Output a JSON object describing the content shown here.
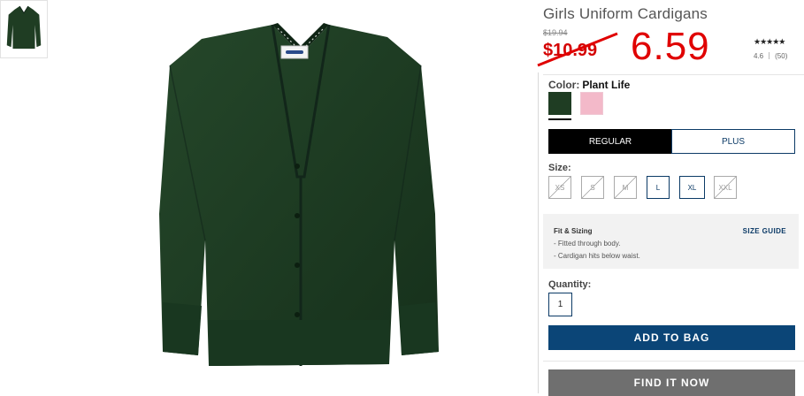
{
  "product": {
    "title": "Girls Uniform Cardigans",
    "old_price": "$19.94",
    "sale_price": "$10.99",
    "new_price": "6.59",
    "rating_stars": "★★★★★",
    "rating_value": "4.6",
    "review_count": "(50)"
  },
  "color": {
    "label": "Color:",
    "selected": "Plant Life",
    "swatches": [
      {
        "name": "Plant Life",
        "hex": "#1f3d23"
      },
      {
        "name": "pink",
        "hex": "#f3b9c9"
      }
    ]
  },
  "fit_tabs": {
    "regular": "REGULAR",
    "plus": "PLUS"
  },
  "sizes": {
    "label": "Size:",
    "options": [
      "XS",
      "S",
      "M",
      "L",
      "XL",
      "XXL"
    ]
  },
  "fit_sizing": {
    "title": "Fit & Sizing",
    "guide_link": "SIZE GUIDE",
    "line1": "- Fitted through body.",
    "line2": "- Cardigan hits below waist."
  },
  "quantity": {
    "label": "Quantity:",
    "value": "1"
  },
  "buttons": {
    "add_to_bag": "ADD TO BAG",
    "find_it_now": "FIND IT NOW"
  },
  "colors": {
    "accent_blue": "#0b4577",
    "sale_red": "#d40000",
    "cardigan_green": "#1f3d23"
  }
}
